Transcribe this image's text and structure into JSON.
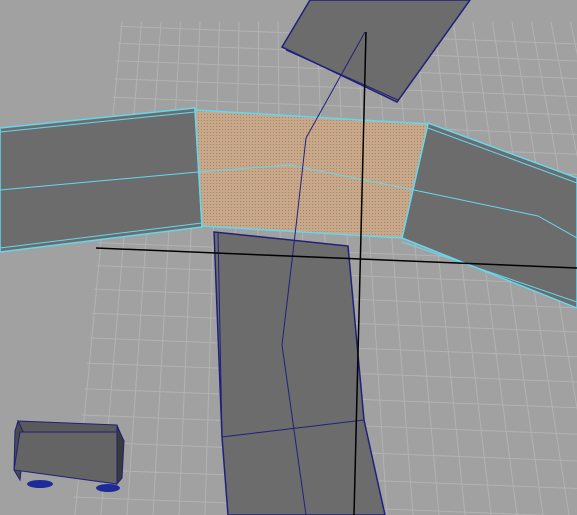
{
  "viewport": {
    "background_color": "#a1a1a1",
    "grid_color": "#b3b3b3",
    "axis_color": "#000000",
    "wireframe_color": "#20207a",
    "selected_wire_color": "#63d8f0",
    "face_color": "#6c6c6c",
    "selected_face_tint": "#c8a889",
    "vehicle_wheel_color": "#1c2a9a"
  },
  "objects": [
    {
      "name": "road-segment-top",
      "selected": false
    },
    {
      "name": "road-segment-left",
      "selected": true
    },
    {
      "name": "road-intersection",
      "selected": true
    },
    {
      "name": "road-segment-right",
      "selected": true
    },
    {
      "name": "road-segment-bottom",
      "selected": false
    },
    {
      "name": "vehicle",
      "selected": false
    }
  ]
}
